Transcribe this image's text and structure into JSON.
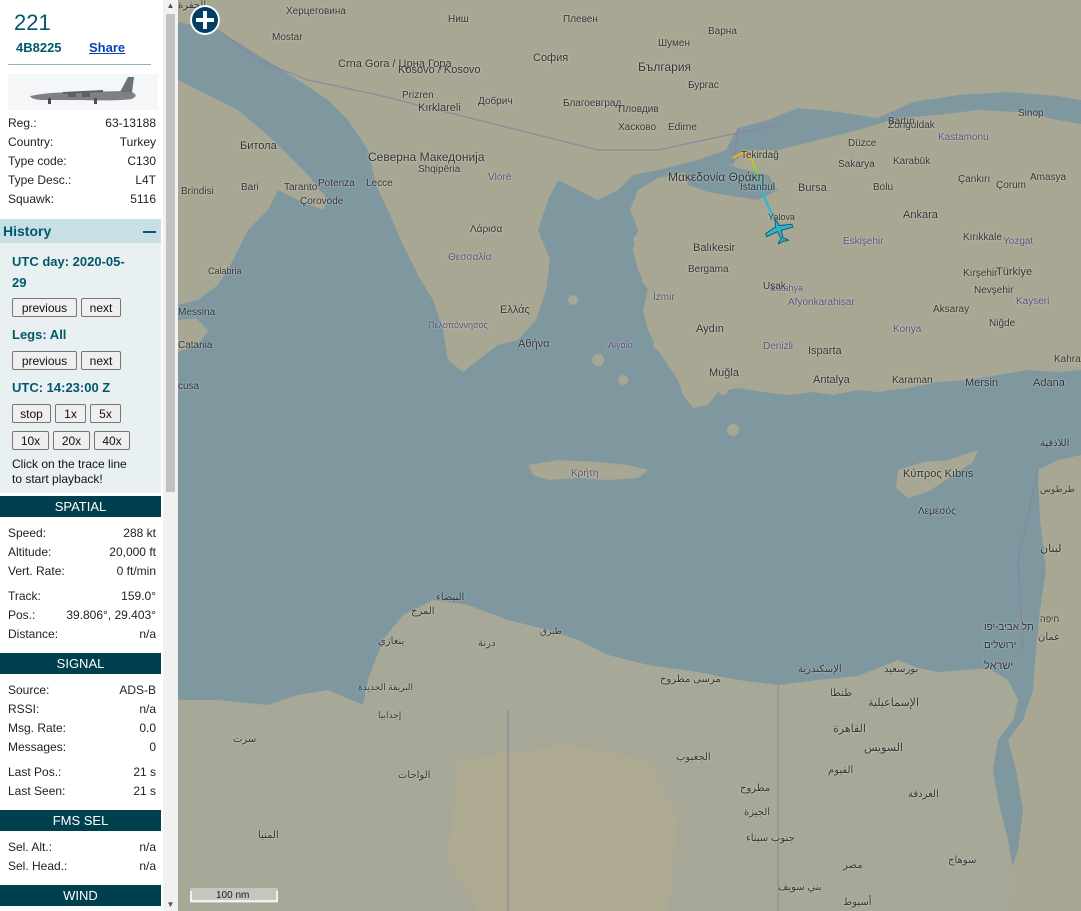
{
  "aircraft": {
    "callsign": "221",
    "hex": "4B8225",
    "share_label": "Share"
  },
  "details": [
    {
      "label": "Reg.:",
      "value": "63-13188"
    },
    {
      "label": "Country:",
      "value": "Turkey"
    },
    {
      "label": "Type code:",
      "value": "C130"
    },
    {
      "label": "Type Desc.:",
      "value": "L4T"
    },
    {
      "label": "Squawk:",
      "value": "5116"
    }
  ],
  "history": {
    "title": "History",
    "utc_day_label": "UTC day: 2020-05-",
    "utc_day_label2": "29",
    "previous_label": "previous",
    "next_label": "next",
    "legs_label": "Legs: All",
    "utc_time": "UTC: 14:23:00 Z",
    "stop_label": "stop",
    "speeds": [
      "1x",
      "5x",
      "10x",
      "20x",
      "40x"
    ],
    "hint_line1": "Click on the trace line",
    "hint_line2": "to start playback!"
  },
  "spatial": {
    "title": "SPATIAL",
    "rows": [
      {
        "label": "Speed:",
        "value": "288 kt"
      },
      {
        "label": "Altitude:",
        "value": "20,000 ft"
      },
      {
        "label": "Vert. Rate:",
        "value": "0 ft/min"
      },
      {
        "label": "Track:",
        "value": "159.0°"
      },
      {
        "label": "Pos.:",
        "value": "39.806°, 29.403°"
      },
      {
        "label": "Distance:",
        "value": "n/a"
      }
    ]
  },
  "signal": {
    "title": "SIGNAL",
    "rows": [
      {
        "label": "Source:",
        "value": "ADS-B"
      },
      {
        "label": "RSSI:",
        "value": "n/a"
      },
      {
        "label": "Msg. Rate:",
        "value": "0.0"
      },
      {
        "label": "Messages:",
        "value": "0"
      },
      {
        "label": "Last Pos.:",
        "value": "21 s"
      },
      {
        "label": "Last Seen:",
        "value": "21 s"
      }
    ]
  },
  "fms": {
    "title": "FMS SEL",
    "rows": [
      {
        "label": "Sel. Alt.:",
        "value": "n/a"
      },
      {
        "label": "Sel. Head.:",
        "value": "n/a"
      }
    ]
  },
  "wind": {
    "title": "WIND"
  },
  "map": {
    "scale_label": "100 nm",
    "zoom_icon": "plus-icon",
    "colors": {
      "sea": "#7f98a0",
      "land": "#a7a793",
      "track_start": "#f5a623",
      "track_end": "#3fb7c9",
      "aircraft": "#2fb5d0"
    },
    "labels": [
      {
        "text": "Херцеговина"
      },
      {
        "text": "Mostar"
      },
      {
        "text": "Crna Gora / Црна Гора"
      },
      {
        "text": "Kosovo / Kosovo"
      },
      {
        "text": "Prizren"
      },
      {
        "text": "Ниш"
      },
      {
        "text": "София"
      },
      {
        "text": "Плевен"
      },
      {
        "text": "Шумен"
      },
      {
        "text": "България"
      },
      {
        "text": "Бургас"
      },
      {
        "text": "Варна"
      },
      {
        "text": "Добрич"
      },
      {
        "text": "Благоевград"
      },
      {
        "text": "Пловдив"
      },
      {
        "text": "Хасково"
      },
      {
        "text": "Edirne"
      },
      {
        "text": "Kırklareli"
      },
      {
        "text": "Северна Македонија"
      },
      {
        "text": "Shqipëria"
      },
      {
        "text": "Битола"
      },
      {
        "text": "Bari"
      },
      {
        "text": "Taranto"
      },
      {
        "text": "Brindisi"
      },
      {
        "text": "Potenza"
      },
      {
        "text": "Lecce"
      },
      {
        "text": "Çorovode"
      },
      {
        "text": "Vlorë"
      },
      {
        "text": "Μακεδονία Θράκη"
      },
      {
        "text": "Tekirdağ"
      },
      {
        "text": "İstanbul"
      },
      {
        "text": "Yalova"
      },
      {
        "text": "Bursa"
      },
      {
        "text": "Sakarya"
      },
      {
        "text": "Düzce"
      },
      {
        "text": "Zonguldak"
      },
      {
        "text": "Karabük"
      },
      {
        "text": "Bartın"
      },
      {
        "text": "Sinop"
      },
      {
        "text": "Kastamonu"
      },
      {
        "text": "Çankırı"
      },
      {
        "text": "Bolu"
      },
      {
        "text": "Çorum"
      },
      {
        "text": "Amasya"
      },
      {
        "text": "Ankara"
      },
      {
        "text": "Kırıkkale"
      },
      {
        "text": "Yozgat"
      },
      {
        "text": "Eskişehir"
      },
      {
        "text": "Balıkesir"
      },
      {
        "text": "Bergama"
      },
      {
        "text": "Kütahya"
      },
      {
        "text": "Uşak"
      },
      {
        "text": "Afyonkarahisar"
      },
      {
        "text": "İzmir"
      },
      {
        "text": "Aydın"
      },
      {
        "text": "Denizli"
      },
      {
        "text": "Isparta"
      },
      {
        "text": "Konya"
      },
      {
        "text": "Kırşehir"
      },
      {
        "text": "Nevşehir"
      },
      {
        "text": "Türkiye"
      },
      {
        "text": "Aksaray"
      },
      {
        "text": "Niğde"
      },
      {
        "text": "Kayseri"
      },
      {
        "text": "Muğla"
      },
      {
        "text": "Antalya"
      },
      {
        "text": "Karaman"
      },
      {
        "text": "Mersin"
      },
      {
        "text": "Adana"
      },
      {
        "text": "Kahra"
      },
      {
        "text": "Ελλάς"
      },
      {
        "text": "Αθήνα"
      },
      {
        "text": "Λάρισα"
      },
      {
        "text": "Θεσσαλία"
      },
      {
        "text": "Πελοπόννησος"
      },
      {
        "text": "Αιγαίο"
      },
      {
        "text": "Κρήτη"
      },
      {
        "text": "Κύπρος Kıbrıs"
      },
      {
        "text": "Λεμεσός"
      },
      {
        "text": "Calabria"
      },
      {
        "text": "Messina"
      },
      {
        "text": "Catania"
      },
      {
        "text": "cusa"
      },
      {
        "text": "اللاذقية"
      },
      {
        "text": "طرطوس"
      },
      {
        "text": "لبنان"
      },
      {
        "text": "חיפה"
      },
      {
        "text": "תל אביב-יפו"
      },
      {
        "text": "ירושלים"
      },
      {
        "text": "ישראל"
      },
      {
        "text": "عمان"
      },
      {
        "text": "البيضاء"
      },
      {
        "text": "المرج"
      },
      {
        "text": "بنغازي"
      },
      {
        "text": "درنة"
      },
      {
        "text": "طبرق"
      },
      {
        "text": "مرسى مطروح"
      },
      {
        "text": "الإسكندرية"
      },
      {
        "text": "بورسعيد"
      },
      {
        "text": "طنطا"
      },
      {
        "text": "الإسماعيلية"
      },
      {
        "text": "القاهرة"
      },
      {
        "text": "السويس"
      },
      {
        "text": "الفيوم"
      },
      {
        "text": "إجدابيا"
      },
      {
        "text": "البريقة الجديدة"
      },
      {
        "text": "الواحات"
      },
      {
        "text": "سرت"
      },
      {
        "text": "الجغبوب"
      },
      {
        "text": "مطروح"
      },
      {
        "text": "الجيزة"
      },
      {
        "text": "بني سويف"
      },
      {
        "text": "مصر"
      },
      {
        "text": "أسيوط"
      },
      {
        "text": "سوهاج"
      },
      {
        "text": "الغردقة"
      },
      {
        "text": "جنوب سيناء"
      },
      {
        "text": "المنيا"
      },
      {
        "text": "الجفرة"
      }
    ]
  }
}
